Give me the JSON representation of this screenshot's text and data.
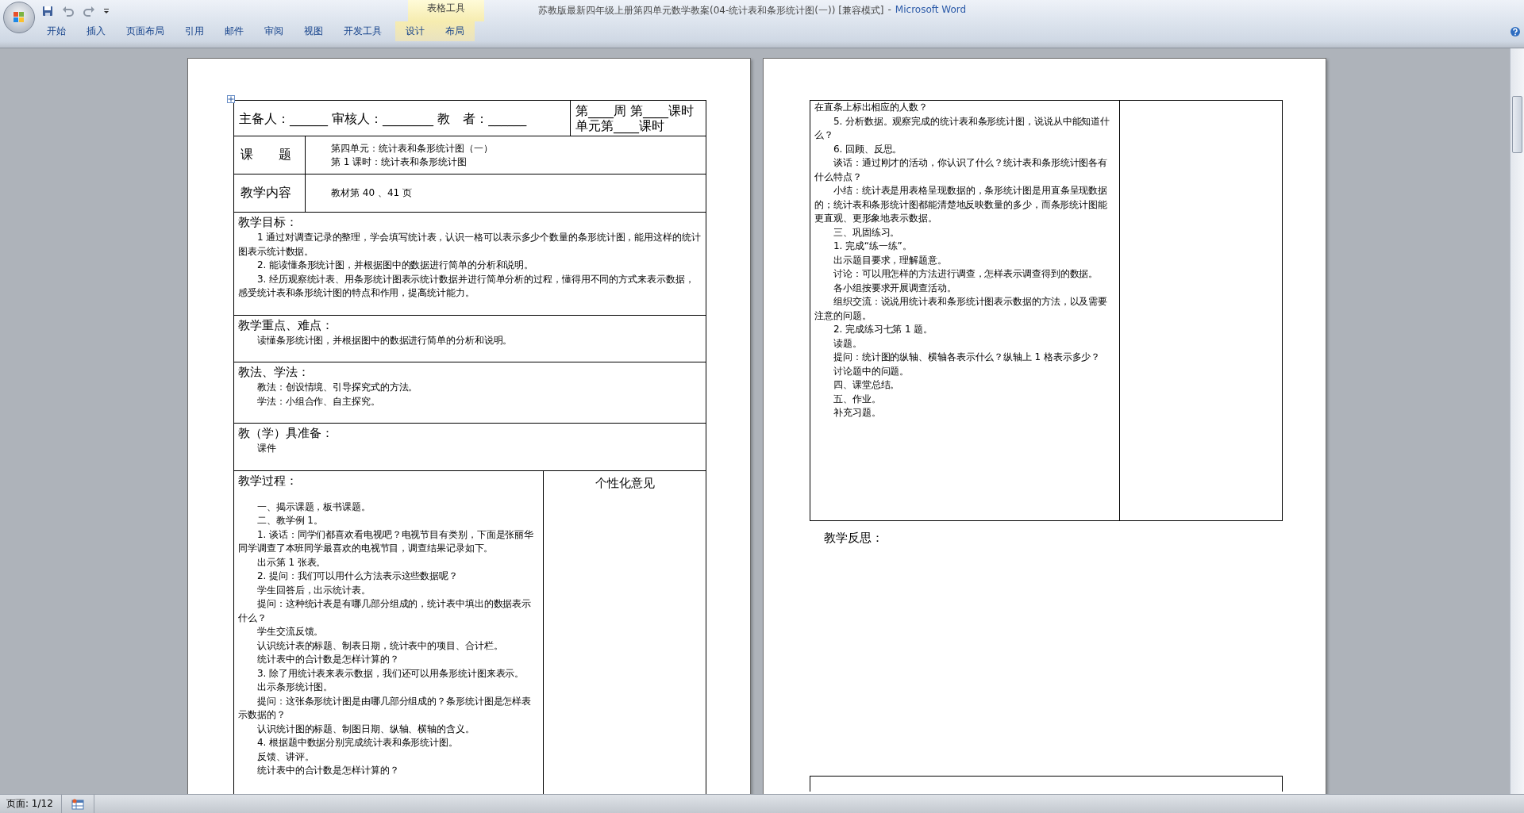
{
  "window": {
    "document_title": "苏教版最新四年级上册第四单元数学教案(04-统计表和条形统计图(一)) [兼容模式]",
    "separator": "-",
    "app_name": "Microsoft Word"
  },
  "ribbon_tabs": [
    {
      "label": "开始"
    },
    {
      "label": "插入"
    },
    {
      "label": "页面布局"
    },
    {
      "label": "引用"
    },
    {
      "label": "邮件"
    },
    {
      "label": "审阅"
    },
    {
      "label": "视图"
    },
    {
      "label": "开发工具"
    }
  ],
  "contextual_tabs": {
    "group": "表格工具",
    "tabs": [
      {
        "label": "设计"
      },
      {
        "label": "布局"
      }
    ]
  },
  "left_page": {
    "header": {
      "staff": "主备人：______ 审核人：________ 教　者：______",
      "schedule": [
        "第____周 第____课时",
        "单元第____课时"
      ]
    },
    "label_rows": [
      {
        "label": "课　　题",
        "lines": [
          "第四单元：统计表和条形统计图（一）",
          "第 1 课时：统计表和条形统计图"
        ]
      },
      {
        "label": "教学内容",
        "lines": [
          "教材第 40 、41 页"
        ]
      }
    ],
    "sections": [
      {
        "heading": "教学目标：",
        "paragraphs": [
          "1 通过对调查记录的整理，学会填写统计表，认识一格可以表示多少个数量的条形统计图，能用这样的统计图表示统计数据。",
          "2. 能读懂条形统计图，并根据图中的数据进行简单的分析和说明。",
          "3. 经历观察统计表、用条形统计图表示统计数据并进行简单分析的过程，懂得用不同的方式来表示数据，感受统计表和条形统计图的特点和作用，提高统计能力。"
        ]
      },
      {
        "heading": "教学重点、难点：",
        "paragraphs": [
          "读懂条形统计图，并根据图中的数据进行简单的分析和说明。"
        ]
      },
      {
        "heading": "教法、学法：",
        "paragraphs": [
          "教法：创设情境、引导探究式的方法。",
          "学法：小组合作、自主探究。"
        ]
      },
      {
        "heading": "教（学）具准备：",
        "paragraphs": [
          "课件"
        ]
      }
    ],
    "process": {
      "heading": "教学过程：",
      "side_heading": "个性化意见",
      "paragraphs": [
        "一、揭示课题，板书课题。",
        "二、教学例 1。",
        "1. 谈话：同学们都喜欢看电视吧？电视节目有类别，下面是张丽华同学调查了本班同学最喜欢的电视节目，调查结果记录如下。",
        "出示第 1 张表。",
        "2. 提问：我们可以用什么方法表示这些数据呢？",
        "学生回答后，出示统计表。",
        "提问：这种统计表是有哪几部分组成的，统计表中填出的数据表示什么？",
        "学生交流反馈。",
        "认识统计表的标题、制表日期，统计表中的项目、合计栏。",
        "统计表中的合计数是怎样计算的？",
        "3. 除了用统计表来表示数据，我们还可以用条形统计图来表示。",
        "出示条形统计图。",
        "提问：这张条形统计图是由哪几部分组成的？条形统计图是怎样表示数据的？",
        "认识统计图的标题、制图日期、纵轴、横轴的含义。",
        "4. 根据题中数据分别完成统计表和条形统计图。",
        "反馈、讲评。",
        "统计表中的合计数是怎样计算的？"
      ]
    }
  },
  "right_page": {
    "continued_text": "在直条上标出相应的人数？",
    "paragraphs": [
      "5. 分析数据。观察完成的统计表和条形统计图，说说从中能知道什么？",
      "6. 回顾、反思。",
      "谈话：通过刚才的活动，你认识了什么？统计表和条形统计图各有什么特点？",
      "小结：统计表是用表格呈现数据的，条形统计图是用直条呈现数据的；统计表和条形统计图都能清楚地反映数量的多少，而条形统计图能更直观、更形象地表示数据。",
      "三、巩固练习。",
      "1. 完成“练一练”。",
      "出示题目要求，理解题意。",
      "讨论：可以用怎样的方法进行调查，怎样表示调查得到的数据。",
      "各小组按要求开展调查活动。",
      "组织交流：说说用统计表和条形统计图表示数据的方法，以及需要注意的问题。",
      "2. 完成练习七第 1 题。",
      "读题。",
      "提问：统计图的纵轴、横轴各表示什么？纵轴上 1 格表示多少？",
      "讨论题中的问题。",
      "四、课堂总结。",
      "五、作业。",
      "补充习题。"
    ],
    "reflection_heading": "教学反思："
  },
  "status_bar": {
    "page": "页面: 1/12"
  }
}
